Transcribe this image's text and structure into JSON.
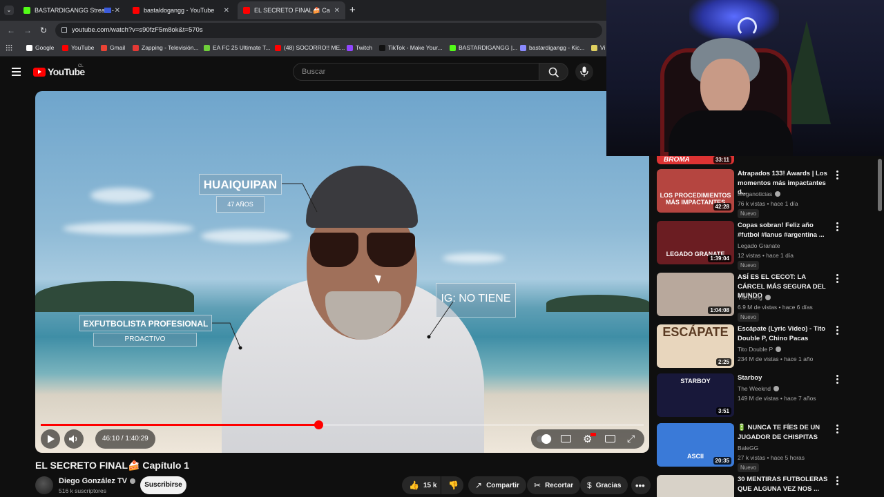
{
  "browser": {
    "tabs": [
      {
        "label": "BASTARDIGANGG Stream - ",
        "color": "#53fc18"
      },
      {
        "label": "bastaldogangg - YouTube",
        "color": "#ff0000"
      },
      {
        "label": "EL SECRETO FINAL🍰 Capítulo",
        "color": "#ff0000",
        "active": true
      }
    ],
    "url": "youtube.com/watch?v=s90fzF5m8ok&t=570s",
    "bookmarks": [
      {
        "label": "Google",
        "color": "#ffffff"
      },
      {
        "label": "YouTube",
        "color": "#ff0000"
      },
      {
        "label": "Gmail",
        "color": "#ea4335"
      },
      {
        "label": "Zapping - Televisión...",
        "color": "#e53935"
      },
      {
        "label": "EA FC 25 Ultimate T...",
        "color": "#6fcf3a"
      },
      {
        "label": "(48) SOCORRO!! ME...",
        "color": "#ff0000"
      },
      {
        "label": "Twitch",
        "color": "#9146ff"
      },
      {
        "label": "TikTok - Make Your...",
        "color": "#111111"
      },
      {
        "label": "BASTARDIGANGG |...",
        "color": "#53fc18"
      },
      {
        "label": "bastardigangg - Kic...",
        "color": "#8a8aff"
      },
      {
        "label": "Vi",
        "color": "#e0d060"
      }
    ]
  },
  "youtube": {
    "logo_text": "YouTube",
    "country": "CL",
    "search_placeholder": "Buscar"
  },
  "video": {
    "overlays": {
      "name": "HUAIQUIPAN",
      "age": "47 AÑOS",
      "profession": "EXFUTBOLISTA PROFESIONAL",
      "trait": "PROACTIVO",
      "ig": "IG: NO TIENE"
    },
    "time": "46:10 / 1:40:29",
    "progress": 0.46,
    "title": "EL SECRETO FINAL🍰 Capítulo 1",
    "channel": "Diego González TV",
    "subscribers": "516 k suscriptores",
    "subscribe_label": "Suscribirse",
    "likes": "15 k",
    "share_label": "Compartir",
    "clip_label": "Recortar",
    "thanks_label": "Gracias"
  },
  "recommendations": [
    {
      "title": "Atrapados 133! Awards | Los momentos más impactantes d...",
      "channel": "Meganoticias",
      "verified": true,
      "meta": "76 k vistas • hace 1 día",
      "duration": "42:28",
      "nuevo": "Nuevo",
      "thumb_text": "LOS PROCEDIMIENTOS MÁS IMPACTANTES",
      "thumb_color": "#b54540"
    },
    {
      "title": "Copas sobran! Feliz año #futbol #lanus #argentina ...",
      "channel": "Legado Granate",
      "verified": false,
      "meta": "12 vistas • hace 1 día",
      "duration": "1:39:04",
      "nuevo": "Nuevo",
      "thumb_text": "LEGADO GRANATE",
      "thumb_color": "#6b1d22"
    },
    {
      "title": "ASÍ ES EL CECOT: LA CÁRCEL MÁS SEGURA DEL MUNDO",
      "channel": "TheGrefg",
      "verified": true,
      "meta": "6.9 M de vistas • hace 6 días",
      "duration": "1:04:08",
      "nuevo": "Nuevo",
      "thumb_text": "",
      "thumb_color": "#b8a89c"
    },
    {
      "title": "Escápate (Lyric Video) - Tito Double P, Chino Pacas",
      "channel": "Tito Double P",
      "verified": true,
      "meta": "234 M de vistas • hace 1 año",
      "duration": "2:25",
      "nuevo": "",
      "thumb_text": "ESCÁPATE",
      "thumb_color": "#e8d6bd"
    },
    {
      "title": "Starboy",
      "channel": "The Weeknd",
      "verified": true,
      "meta": "149 M de vistas • hace 7 años",
      "duration": "3:51",
      "nuevo": "",
      "thumb_text": "STARBOY",
      "thumb_color": "#18183a"
    },
    {
      "title": "🔋 NUNCA TE FÍES DE UN JUGADOR DE CHISPITAS",
      "channel": "BaleGG",
      "verified": false,
      "meta": "27 k vistas • hace 5 horas",
      "duration": "20:35",
      "nuevo": "Nuevo",
      "thumb_text": "ASCII",
      "thumb_color": "#3a7ad8"
    },
    {
      "title": "30 MENTIRAS FUTBOLERAS QUE ALGUNA VEZ NOS ...",
      "channel": "",
      "verified": false,
      "meta": "",
      "duration": "",
      "nuevo": "",
      "thumb_text": "",
      "thumb_color": "#d8d2c8"
    }
  ],
  "partial_rec": {
    "thumb_text": "BROMA",
    "duration": "33:11"
  }
}
